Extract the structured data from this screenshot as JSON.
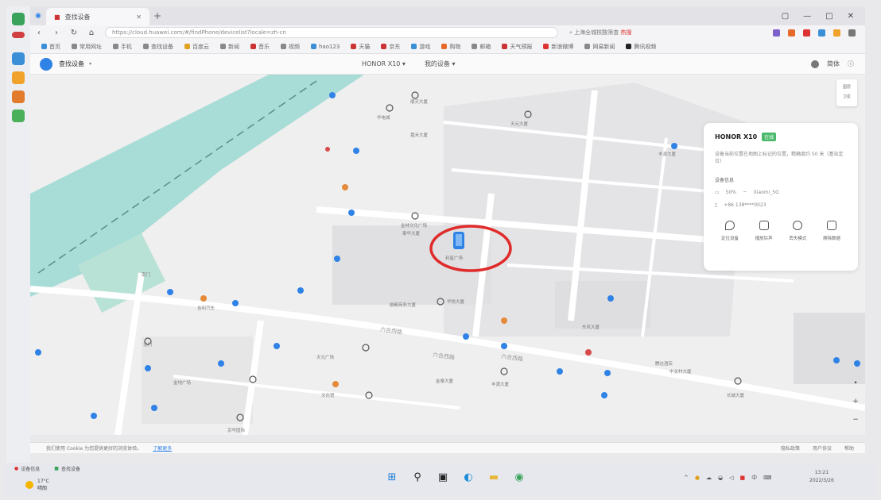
{
  "browser": {
    "tab_title": "查找设备",
    "url": "https://cloud.huawei.com/#/findPhone/devicelist?locale=zh-cn",
    "search_placeholder": "上海全城核酸筛查",
    "search_hot_badge": "热搜",
    "bookmarks": [
      "首页",
      "常用网址",
      "手机",
      "查找设备",
      "百度云",
      "新闻",
      "音乐",
      "视频",
      "hao123",
      "天猫",
      "京东",
      "游戏",
      "购物",
      "邮箱",
      "天气预报",
      "新浪微博",
      "网易新闻",
      "腾讯视频"
    ]
  },
  "site": {
    "title": "查找设备",
    "device_select": "HONOR X10",
    "user_select": "我的设备",
    "lang": "简体"
  },
  "map": {
    "road_labels": [
      "六合西路",
      "六合西路",
      "六合西路"
    ],
    "poi_labels": [
      "顺天大厦",
      "华电城",
      "天元大厦",
      "嘉禾大厦",
      "丰源大厦",
      "金林文化广场",
      "泰华大厦",
      "利星广场",
      "融都商务大厦",
      "华悦大厦",
      "吉利汽车",
      "金地广场",
      "东风大厦",
      "中关村大厦",
      "腾达酒店",
      "长城大厦",
      "天元广场",
      "金泰大厦",
      "丰源大厦",
      "京华国际",
      "南门",
      "北门",
      "文化馆"
    ],
    "layer_ctrl": [
      "图层",
      "卫星"
    ]
  },
  "panel": {
    "device_name": "HONOR X10",
    "status_badge": "在线",
    "description": "设备当前位置在地图上标记的位置，精确度约 50 米（基站定位）",
    "section_title": "设备信息",
    "battery": "50%",
    "wifi": "Xiaomi_5G",
    "phone": "+86 138****0023",
    "actions": [
      "定位设备",
      "播放铃声",
      "丢失模式",
      "擦除数据"
    ]
  },
  "cookie_bar": {
    "text": "我们使用 Cookie 为您提供更好的浏览体验。",
    "link": "了解更多",
    "status_right": [
      "隐私政策",
      "用户协议",
      "帮助"
    ]
  },
  "taskbar": {
    "items": [
      "设备信息",
      "查找设备"
    ],
    "weather_temp": "17°C",
    "weather_desc": "晴朗",
    "time": "13:21",
    "date": "2022/3/26"
  },
  "colors": {
    "water": "#a8dcd6",
    "accent": "#2f82e6",
    "highlight_circle": "#e02b2b"
  }
}
